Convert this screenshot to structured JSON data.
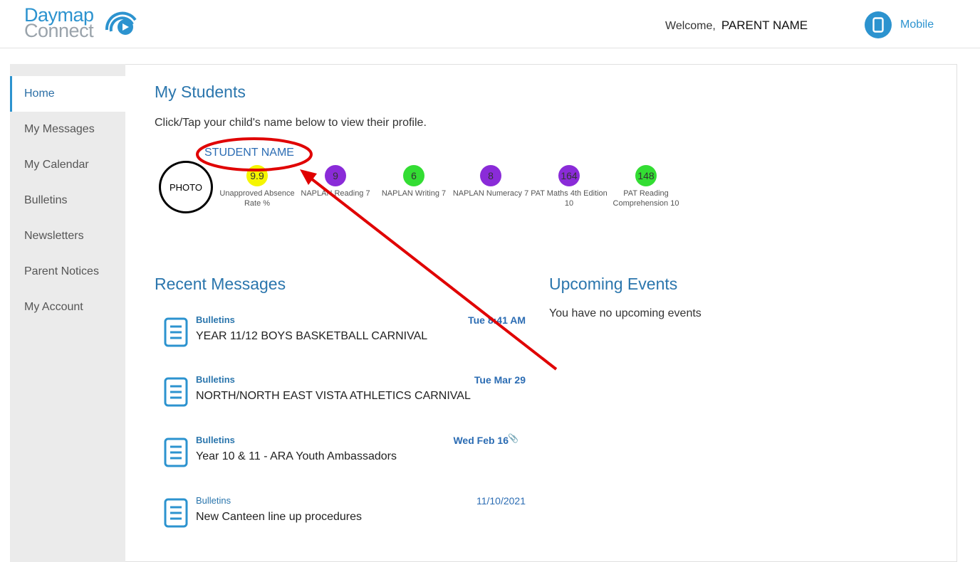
{
  "header": {
    "logo_top": "Daymap",
    "logo_bottom": "Connect",
    "welcome_label": "Welcome,",
    "parent_name": "PARENT NAME",
    "mobile_label": "Mobile"
  },
  "sidebar": {
    "items": [
      {
        "label": "Home"
      },
      {
        "label": "My Messages"
      },
      {
        "label": "My Calendar"
      },
      {
        "label": "Bulletins"
      },
      {
        "label": "Newsletters"
      },
      {
        "label": "Parent Notices"
      },
      {
        "label": "My Account"
      }
    ]
  },
  "students": {
    "title": "My Students",
    "intro": "Click/Tap your child's name below to view their profile.",
    "student_name": "STUDENT NAME",
    "photo_label": "PHOTO",
    "stats": [
      {
        "value": "9.9",
        "label": "Unapproved Absence Rate %",
        "color": "#f5f500"
      },
      {
        "value": "9",
        "label": "NAPLAN Reading 7",
        "color": "#8a2bd8"
      },
      {
        "value": "6",
        "label": "NAPLAN Writing 7",
        "color": "#33dd33"
      },
      {
        "value": "8",
        "label": "NAPLAN Numeracy 7",
        "color": "#8a2bd8"
      },
      {
        "value": "164",
        "label": "PAT Maths 4th Edition 10",
        "color": "#8a2bd8"
      },
      {
        "value": "148",
        "label": "PAT Reading Comprehension 10",
        "color": "#33dd33"
      }
    ]
  },
  "messages": {
    "title": "Recent Messages",
    "items": [
      {
        "category": "Bulletins",
        "date": "Tue 8:41 AM",
        "title": "YEAR 11/12 BOYS BASKETBALL CARNIVAL"
      },
      {
        "category": "Bulletins",
        "date": "Tue Mar 29",
        "title": "NORTH/NORTH EAST VISTA ATHLETICS CARNIVAL"
      },
      {
        "category": "Bulletins",
        "date": "Wed Feb 16",
        "title": "Year 10 & 11 - ARA Youth Ambassadors"
      },
      {
        "category": "Bulletins",
        "date": "11/10/2021",
        "title": "New Canteen line up procedures"
      }
    ]
  },
  "events": {
    "title": "Upcoming Events",
    "empty_text": "You have no upcoming events"
  },
  "colors": {
    "brand": "#2c93cf",
    "heading": "#2b76ad",
    "annotation": "#e00000"
  }
}
